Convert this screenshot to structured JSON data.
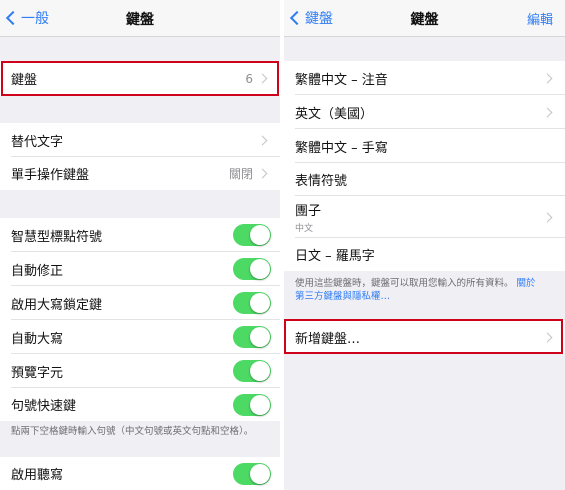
{
  "left": {
    "nav": {
      "back_label": "一般",
      "title": "鍵盤"
    },
    "keyboards_row": {
      "label": "鍵盤",
      "value": "6"
    },
    "text_replacement": {
      "label": "替代文字"
    },
    "one_handed": {
      "label": "單手操作鍵盤",
      "value": "關閉"
    },
    "toggles": [
      {
        "label": "智慧型標點符號",
        "on": true
      },
      {
        "label": "自動修正",
        "on": true
      },
      {
        "label": "啟用大寫鎖定鍵",
        "on": true
      },
      {
        "label": "自動大寫",
        "on": true
      },
      {
        "label": "預覽字元",
        "on": true
      },
      {
        "label": "句號快速鍵",
        "on": true
      }
    ],
    "footnote": "點兩下空格鍵時輸入句號（中文句號或英文句點和空格）。",
    "dictation": {
      "label": "啟用聽寫",
      "on": true
    }
  },
  "right": {
    "nav": {
      "back_label": "鍵盤",
      "title": "鍵盤",
      "edit_label": "編輯"
    },
    "keyboards": [
      {
        "label": "繁體中文 – 注音",
        "subtitle": ""
      },
      {
        "label": "英文（美國）",
        "subtitle": ""
      },
      {
        "label": "繁體中文 – 手寫",
        "subtitle": ""
      },
      {
        "label": "表情符號",
        "subtitle": ""
      },
      {
        "label": "團子",
        "subtitle": "中文"
      },
      {
        "label": "日文 – 羅馬字",
        "subtitle": ""
      }
    ],
    "footnote_text": "使用這些鍵盤時，鍵盤可以取用您輸入的所有資料。",
    "footnote_link_1": "關於",
    "footnote_link_2": "第三方鍵盤與隱私權…",
    "add_keyboard": {
      "label": "新增鍵盤…"
    }
  },
  "colors": {
    "accent": "#2f7cf6",
    "toggle_on": "#4cd964",
    "highlight": "#d0021b"
  }
}
